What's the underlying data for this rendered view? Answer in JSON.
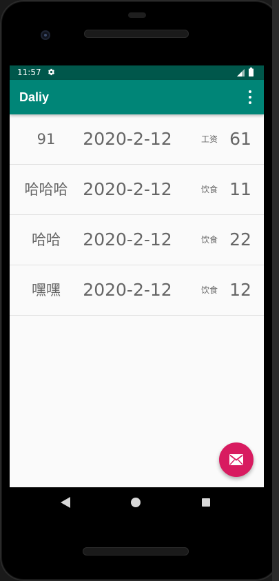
{
  "status_bar": {
    "time": "11:57",
    "background": "#00574b",
    "icons": [
      "gear-icon",
      "signal-icon",
      "battery-icon"
    ]
  },
  "app_bar": {
    "title": "Daliy",
    "background": "#008577",
    "menu_icon": "overflow-menu-icon"
  },
  "records": [
    {
      "name": "91",
      "date": "2020-2-12",
      "category": "工资",
      "amount": "61"
    },
    {
      "name": "哈哈哈",
      "date": "2020-2-12",
      "category": "饮食",
      "amount": "11"
    },
    {
      "name": "哈哈",
      "date": "2020-2-12",
      "category": "饮食",
      "amount": "22"
    },
    {
      "name": "嘿嘿",
      "date": "2020-2-12",
      "category": "饮食",
      "amount": "12"
    }
  ],
  "fab": {
    "icon": "email-icon",
    "color": "#d81b60"
  },
  "nav_bar": {
    "icons": [
      "back-icon",
      "home-icon",
      "recents-icon"
    ]
  }
}
